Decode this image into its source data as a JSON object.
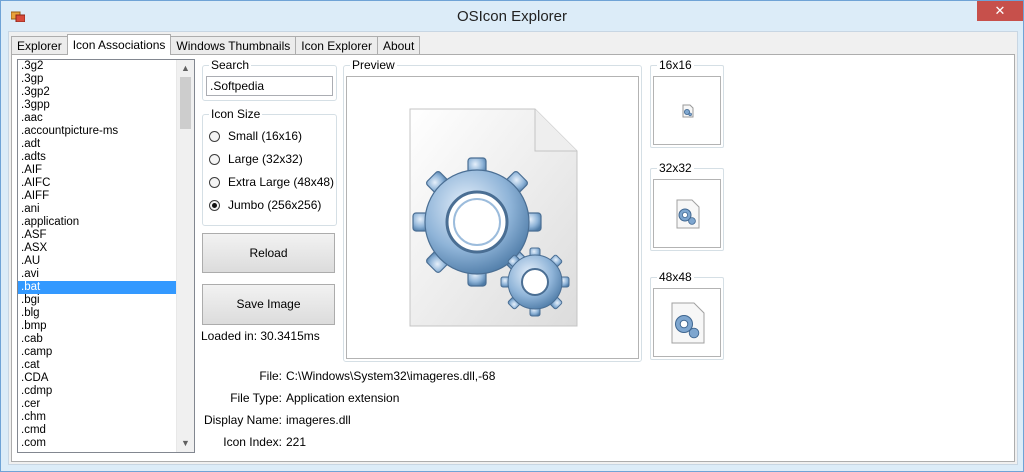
{
  "window": {
    "title": "OSIcon Explorer",
    "close_glyph": "✕",
    "app_icon": "app-icon"
  },
  "tabs": [
    {
      "label": "Explorer",
      "active": false
    },
    {
      "label": "Icon Associations",
      "active": true
    },
    {
      "label": "Windows Thumbnails",
      "active": false
    },
    {
      "label": "Icon Explorer",
      "active": false
    },
    {
      "label": "About",
      "active": false
    }
  ],
  "extensions": {
    "items": [
      ".3g2",
      ".3gp",
      ".3gp2",
      ".3gpp",
      ".aac",
      ".accountpicture-ms",
      ".adt",
      ".adts",
      ".AIF",
      ".AIFC",
      ".AIFF",
      ".ani",
      ".application",
      ".ASF",
      ".ASX",
      ".AU",
      ".avi",
      ".bat",
      ".bgi",
      ".blg",
      ".bmp",
      ".cab",
      ".camp",
      ".cat",
      ".CDA",
      ".cdmp",
      ".cer",
      ".chm",
      ".cmd",
      ".com"
    ],
    "selected": ".bat",
    "scroll_up": "▲",
    "scroll_down": "▼"
  },
  "search": {
    "label": "Search",
    "value": ".Softpedia"
  },
  "icon_size": {
    "label": "Icon Size",
    "options": [
      {
        "label": "Small  (16x16)",
        "checked": false
      },
      {
        "label": "Large  (32x32)",
        "checked": false
      },
      {
        "label": "Extra Large  (48x48)",
        "checked": false
      },
      {
        "label": "Jumbo  (256x256)",
        "checked": true
      }
    ]
  },
  "buttons": {
    "reload": "Reload",
    "save_image": "Save Image"
  },
  "loaded_in": "Loaded in: 30.3415ms",
  "preview": {
    "label": "Preview"
  },
  "sizes": {
    "s16": "16x16",
    "s32": "32x32",
    "s48": "48x48"
  },
  "info": {
    "file_label": "File:",
    "file_value": "C:\\Windows\\System32\\imageres.dll,-68",
    "type_label": "File Type:",
    "type_value": "Application extension",
    "display_label": "Display Name:",
    "display_value": "imageres.dll",
    "index_label": "Icon Index:",
    "index_value": "221"
  },
  "colors": {
    "accent": "#3399ff",
    "close": "#c7504b",
    "frame": "#dcecf8"
  }
}
